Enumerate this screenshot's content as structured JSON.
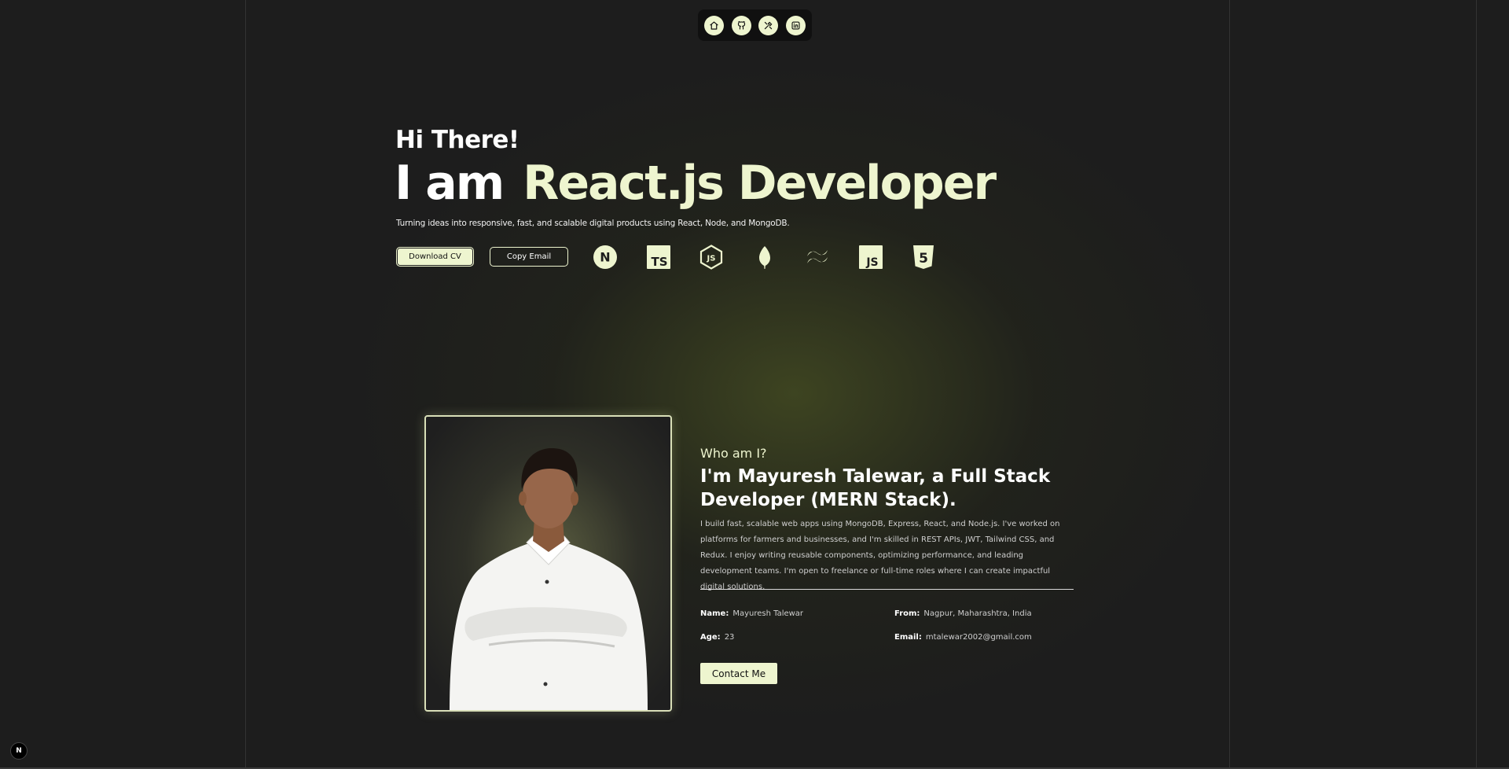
{
  "nav": {
    "items": [
      {
        "icon": "home-icon"
      },
      {
        "icon": "github-icon"
      },
      {
        "icon": "tools-icon"
      },
      {
        "icon": "linkedin-icon"
      }
    ]
  },
  "hero": {
    "greeting": "Hi There!",
    "iam": "I am",
    "role": "React.js Developer",
    "tagline": "Turning ideas into responsive, fast, and scalable digital products using React, Node, and MongoDB.",
    "download_cv_label": "Download CV",
    "copy_email_label": "Copy Email",
    "tech_icons": [
      {
        "name": "nextjs-icon",
        "glyph": "N"
      },
      {
        "name": "typescript-icon",
        "glyph": "TS"
      },
      {
        "name": "nodejs-icon",
        "glyph": "JS"
      },
      {
        "name": "mongodb-icon",
        "glyph": ""
      },
      {
        "name": "tailwind-icon",
        "glyph": ""
      },
      {
        "name": "javascript-icon",
        "glyph": "JS"
      },
      {
        "name": "html5-icon",
        "glyph": "5"
      }
    ]
  },
  "about": {
    "who_label": "Who am I?",
    "title": "I'm Mayuresh Talewar, a Full Stack Developer (MERN Stack).",
    "description": "I build fast, scalable web apps using MongoDB, Express, React, and Node.js. I've worked on platforms for farmers and businesses, and I'm skilled in REST APIs, JWT, Tailwind CSS, and Redux. I enjoy writing reusable components, optimizing performance, and leading development teams. I'm open to freelance or full-time roles where I can create impactful digital solutions.",
    "name_label": "Name:",
    "name_value": "Mayuresh Talewar",
    "from_label": "From:",
    "from_value": "Nagpur, Maharashtra, India",
    "age_label": "Age:",
    "age_value": "23",
    "email_label": "Email:",
    "email_value": "mtalewar2002@gmail.com",
    "contact_label": "Contact Me"
  },
  "badge": {
    "text": "N"
  },
  "colors": {
    "accent": "#eef5cf",
    "background": "#1d1d1d",
    "navbar": "#101010"
  }
}
